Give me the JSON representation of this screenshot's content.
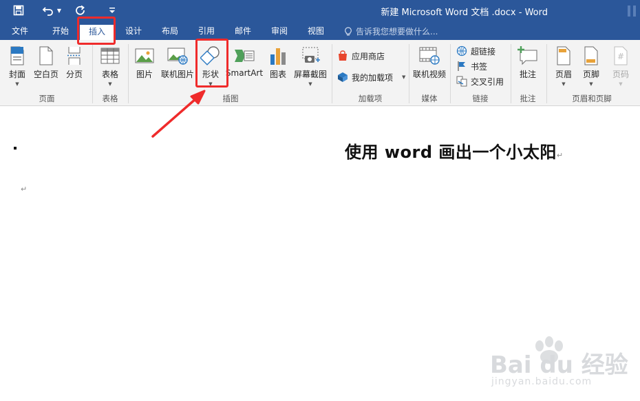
{
  "window": {
    "title": "新建 Microsoft Word 文档 .docx - Word"
  },
  "tabs": [
    {
      "label": "文件"
    },
    {
      "label": "开始"
    },
    {
      "label": "插入"
    },
    {
      "label": "设计"
    },
    {
      "label": "布局"
    },
    {
      "label": "引用"
    },
    {
      "label": "邮件"
    },
    {
      "label": "审阅"
    },
    {
      "label": "视图"
    }
  ],
  "active_tab": "插入",
  "tell_me": "告诉我您想要做什么...",
  "ribbon": {
    "pages": {
      "label": "页面",
      "buttons": [
        "封面",
        "空白页",
        "分页"
      ]
    },
    "tables": {
      "label": "表格",
      "buttons": [
        "表格"
      ]
    },
    "illustrations": {
      "label": "插图",
      "buttons": [
        "图片",
        "联机图片",
        "形状",
        "SmartArt",
        "图表",
        "屏幕截图"
      ]
    },
    "addins": {
      "label": "加载项",
      "buttons": [
        "应用商店",
        "我的加载项"
      ]
    },
    "media": {
      "label": "媒体",
      "buttons": [
        "联机视频"
      ]
    },
    "links": {
      "label": "链接",
      "buttons": [
        "超链接",
        "书签",
        "交叉引用"
      ]
    },
    "comments": {
      "label": "批注",
      "buttons": [
        "批注"
      ]
    },
    "header_footer": {
      "label": "页眉和页脚",
      "buttons": [
        "页眉",
        "页脚",
        "页码"
      ]
    }
  },
  "document": {
    "title_text": "使用 word 画出一个小太阳",
    "paragraph_mark": "↵"
  },
  "watermark": {
    "brand": "Bai du 经验",
    "url": "jingyan.baidu.com"
  },
  "colors": {
    "titlebar": "#2b579a",
    "ribbon": "#f3f3f3",
    "highlight": "#ef2b2b"
  }
}
